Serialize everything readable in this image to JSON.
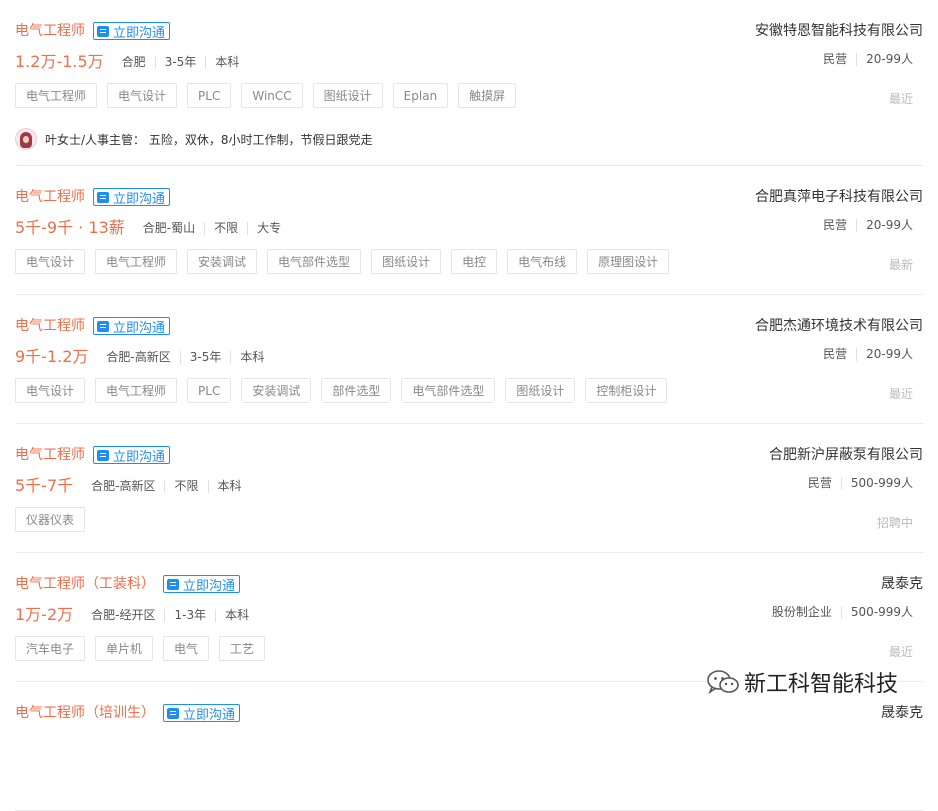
{
  "jobs": [
    {
      "title": "电气工程师",
      "chat_label": "立即沟通",
      "company": "安徽特恩智能科技有限公司",
      "salary": "1.2万-1.5万",
      "meta": [
        "合肥",
        "3-5年",
        "本科"
      ],
      "company_info": [
        "民营",
        "20-99人"
      ],
      "tags": [
        "电气工程师",
        "电气设计",
        "PLC",
        "WinCC",
        "图纸设计",
        "Eplan",
        "触摸屏"
      ],
      "time": "最近",
      "hr_text": "叶女士/人事主管： 五险，双休，8小时工作制，节假日跟党走"
    },
    {
      "title": "电气工程师",
      "chat_label": "立即沟通",
      "company": "合肥真萍电子科技有限公司",
      "salary": "5千-9千 · 13薪",
      "meta": [
        "合肥-蜀山",
        "不限",
        "大专"
      ],
      "company_info": [
        "民营",
        "20-99人"
      ],
      "tags": [
        "电气设计",
        "电气工程师",
        "安装调试",
        "电气部件选型",
        "图纸设计",
        "电控",
        "电气布线",
        "原理图设计"
      ],
      "time": "最新"
    },
    {
      "title": "电气工程师",
      "chat_label": "立即沟通",
      "company": "合肥杰通环境技术有限公司",
      "salary": "9千-1.2万",
      "meta": [
        "合肥-高新区",
        "3-5年",
        "本科"
      ],
      "company_info": [
        "民营",
        "20-99人"
      ],
      "tags": [
        "电气设计",
        "电气工程师",
        "PLC",
        "安装调试",
        "部件选型",
        "电气部件选型",
        "图纸设计",
        "控制柜设计"
      ],
      "time": "最近"
    },
    {
      "title": "电气工程师",
      "chat_label": "立即沟通",
      "company": "合肥新沪屏蔽泵有限公司",
      "salary": "5千-7千",
      "meta": [
        "合肥-高新区",
        "不限",
        "本科"
      ],
      "company_info": [
        "民营",
        "500-999人"
      ],
      "tags": [
        "仪器仪表"
      ],
      "time": "招聘中"
    },
    {
      "title": "电气工程师（工装科）",
      "chat_label": "立即沟通",
      "company": "晟泰克",
      "salary": "1万-2万",
      "meta": [
        "合肥-经开区",
        "1-3年",
        "本科"
      ],
      "company_info": [
        "股份制企业",
        "500-999人"
      ],
      "tags": [
        "汽车电子",
        "单片机",
        "电气",
        "工艺"
      ],
      "time": "最近"
    },
    {
      "title": "电气工程师（培训生）",
      "chat_label": "立即沟通",
      "company": "晟泰克"
    }
  ],
  "watermark": {
    "text": "新工科智能科技",
    "icon": "wechat-icon"
  },
  "colors": {
    "accent": "#f26d49",
    "link": "#1d8ff2",
    "tag_border": "#e6e6e6"
  }
}
